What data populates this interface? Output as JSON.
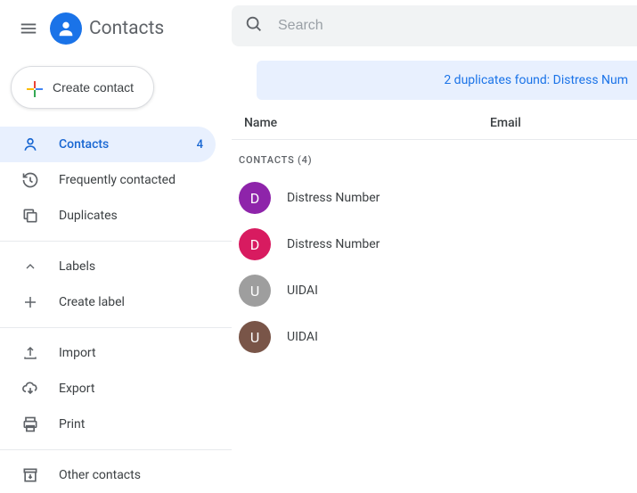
{
  "app": {
    "title": "Contacts"
  },
  "search": {
    "placeholder": "Search"
  },
  "create_button": {
    "label": "Create contact"
  },
  "sidebar": {
    "contacts": {
      "label": "Contacts",
      "count": "4"
    },
    "frequently": {
      "label": "Frequently contacted"
    },
    "duplicates": {
      "label": "Duplicates"
    },
    "labels": {
      "label": "Labels"
    },
    "create_label": {
      "label": "Create label"
    },
    "import": {
      "label": "Import"
    },
    "export": {
      "label": "Export"
    },
    "print": {
      "label": "Print"
    },
    "other": {
      "label": "Other contacts"
    }
  },
  "banner": {
    "text": "2 duplicates found: Distress Num"
  },
  "columns": {
    "name": "Name",
    "email": "Email"
  },
  "section": {
    "label": "CONTACTS (4)"
  },
  "contacts": [
    {
      "initial": "D",
      "name": "Distress Number",
      "color": "#8e24aa"
    },
    {
      "initial": "D",
      "name": "Distress Number",
      "color": "#d81b60"
    },
    {
      "initial": "U",
      "name": "UIDAI",
      "color": "#9e9e9e"
    },
    {
      "initial": "U",
      "name": "UIDAI",
      "color": "#795548"
    }
  ]
}
